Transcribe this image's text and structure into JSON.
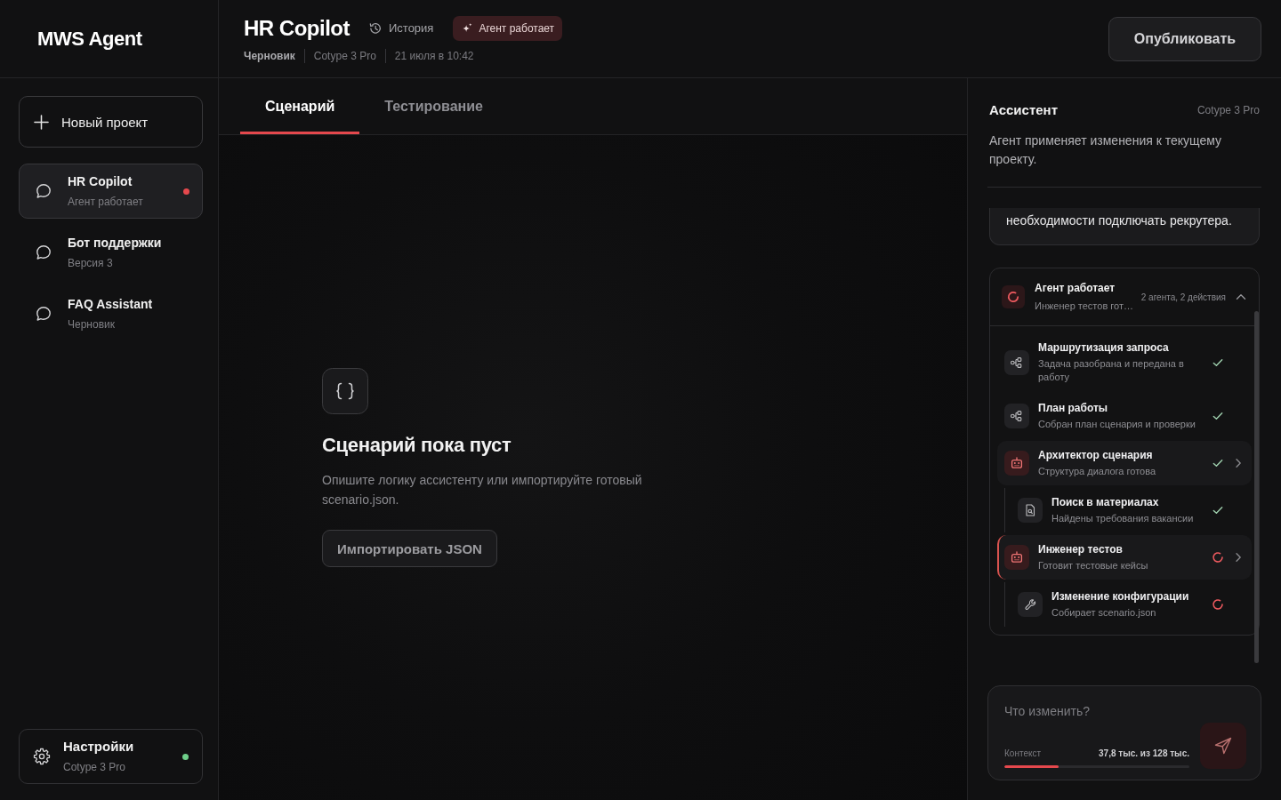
{
  "app": {
    "logo": "MWS Agent"
  },
  "header": {
    "title": "HR Copilot",
    "history_link": "История",
    "status_badge": "Агент работает",
    "meta": {
      "status": "Черновик",
      "model": "Cotype 3 Pro",
      "updated": "21 июля в 10:42"
    },
    "publish_button": "Опубликовать"
  },
  "sidebar": {
    "new_project_button": "Новый проект",
    "projects": [
      {
        "name": "HR Copilot",
        "subtitle": "Агент работает",
        "selected": true,
        "running": true
      },
      {
        "name": "Бот поддержки",
        "subtitle": "Версия 3",
        "selected": false,
        "running": false
      },
      {
        "name": "FAQ Assistant",
        "subtitle": "Черновик",
        "selected": false,
        "running": false
      }
    ],
    "settings": {
      "label": "Настройки",
      "subtitle": "Cotype 3 Pro",
      "connected": true
    }
  },
  "tabs": [
    {
      "label": "Сценарий",
      "selected": true
    },
    {
      "label": "Тестирование",
      "selected": false
    }
  ],
  "empty_state": {
    "title": "Сценарий пока пуст",
    "description": "Опишите логику ассистенту или импортируйте готовый scenario.json.",
    "import_button": "Импортировать JSON"
  },
  "assistant": {
    "title": "Ассистент",
    "model": "Cotype 3 Pro",
    "description": "Агент применяет изменения к текущему проекту.",
    "messages": [
      {
        "text": "необходимости подключать рекрутера."
      }
    ],
    "agent_run": {
      "title": "Агент работает",
      "subtitle": "Инженер тестов гот…",
      "summary": "2 агента, 2 действия",
      "expanded": true,
      "steps": [
        {
          "kind": "route",
          "title": "Маршрутизация запроса",
          "detail": "Задача разобрана и передана в работу",
          "completed": true
        },
        {
          "kind": "route",
          "title": "План работы",
          "detail": "Собран план сценария и проверки",
          "completed": true
        },
        {
          "kind": "agent",
          "title": "Архитектор сценария",
          "detail": "Структура диалога готова",
          "completed": true,
          "children": [
            {
              "kind": "search",
              "title": "Поиск в материалах",
              "detail": "Найдены требования вакансии",
              "completed": true
            }
          ]
        },
        {
          "kind": "agent",
          "title": "Инженер тестов",
          "detail": "Готовит тестовые кейсы",
          "completed": false,
          "children": [
            {
              "kind": "config",
              "title": "Изменение конфигурации",
              "detail": "Собирает scenario.json",
              "completed": false
            }
          ]
        }
      ]
    },
    "composer": {
      "placeholder": "Что изменить?",
      "context_label": "Контекст",
      "context_reading": "37,8 тыс. из 128 тыс.",
      "level": 0.295
    }
  }
}
